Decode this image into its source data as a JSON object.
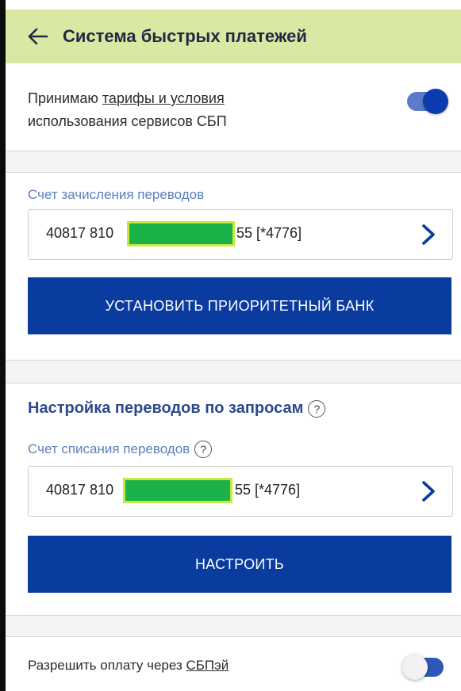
{
  "header": {
    "title": "Система быстрых платежей",
    "back_icon": "arrow-left-icon"
  },
  "accept": {
    "prefix": "Принимаю ",
    "link": "тарифы и условия",
    "suffix": "использования сервисов СБП",
    "toggle_on": true
  },
  "credit_account": {
    "label": "Счет зачисления переводов",
    "number_prefix": "40817 810",
    "number_suffix": "55 [*4776]"
  },
  "priority_button": {
    "label": "УСТАНОВИТЬ ПРИОРИТЕТНЫЙ БАНК"
  },
  "requests": {
    "heading": "Настройка переводов по запросам",
    "debit_label": "Счет списания переводов",
    "number_prefix": "40817 810",
    "number_suffix": "55 [*4776]",
    "help_symbol": "?"
  },
  "configure_button": {
    "label": "НАСТРОИТЬ"
  },
  "sbpay": {
    "prefix": "Разрешить оплату через ",
    "link": "СБПэй",
    "toggle_on": false
  },
  "colors": {
    "header_bg": "#d9e8a2",
    "primary": "#0a3b9e",
    "label": "#5a7fbe",
    "mask": "#1bb24a",
    "mask_outline": "#c8e83c"
  }
}
